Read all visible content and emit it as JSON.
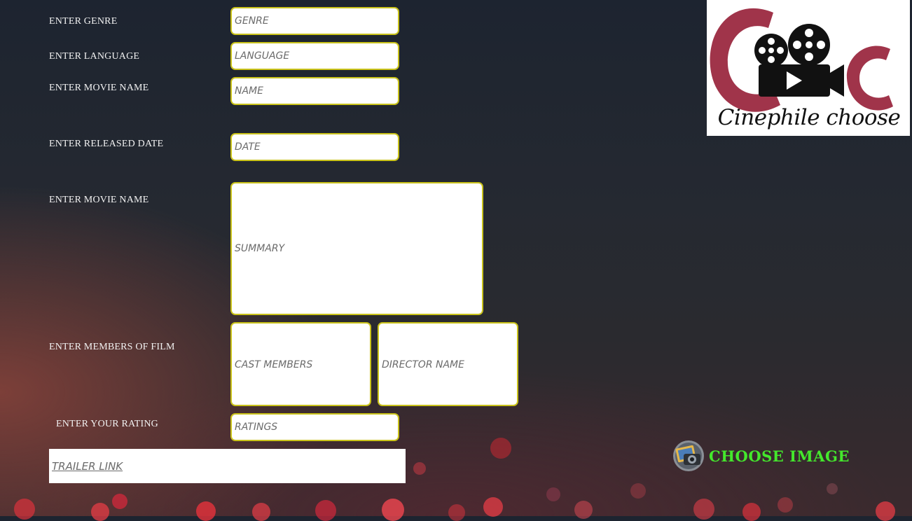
{
  "form": {
    "genre": {
      "label": "ENTER GENRE",
      "placeholder": "GENRE"
    },
    "language": {
      "label": "ENTER LANGUAGE",
      "placeholder": "LANGUAGE"
    },
    "movie_name": {
      "label": "ENTER MOVIE NAME",
      "placeholder": "NAME"
    },
    "release_date": {
      "label": "ENTER RELEASED DATE",
      "placeholder": "DATE"
    },
    "summary": {
      "label": "ENTER MOVIE NAME",
      "placeholder": "SUMMARY"
    },
    "members": {
      "label": "ENTER MEMBERS OF FILM",
      "cast_placeholder": "CAST MEMBERS",
      "director_placeholder": "DIRECTOR NAME"
    },
    "rating": {
      "label": "ENTER YOUR RATING",
      "placeholder": "RATINGS"
    },
    "trailer": {
      "placeholder": "TRAILER LINK"
    }
  },
  "logo": {
    "text": "Cinephile choose",
    "icon": "film-camera-icon",
    "accent": "#a0344a"
  },
  "choose_image": {
    "label": "CHOOSE IMAGE",
    "icon": "photo-camera-icon",
    "color": "#44e82c"
  },
  "colors": {
    "field_border": "#c9c21a",
    "label_text": "#f2f2f2"
  }
}
